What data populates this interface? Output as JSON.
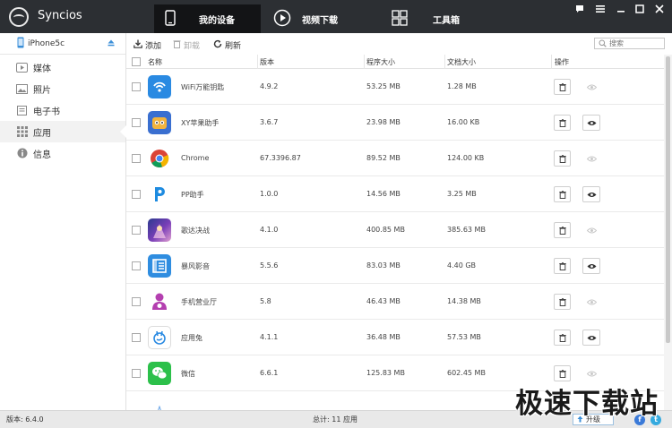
{
  "app": {
    "title": "Syncios"
  },
  "nav": {
    "tabs": [
      {
        "label": "我的设备",
        "icon": "phone-icon",
        "active": true
      },
      {
        "label": "视频下载",
        "icon": "play-icon",
        "active": false
      },
      {
        "label": "工具箱",
        "icon": "toolbox-icon",
        "active": false
      }
    ]
  },
  "window_controls": [
    "chat-icon",
    "menu-icon",
    "minimize-icon",
    "maximize-icon",
    "close-icon"
  ],
  "device": {
    "name": "iPhone5c"
  },
  "sidebar": {
    "items": [
      {
        "label": "媒体",
        "icon": "media-icon",
        "active": false
      },
      {
        "label": "照片",
        "icon": "photo-icon",
        "active": false
      },
      {
        "label": "电子书",
        "icon": "ebook-icon",
        "active": false
      },
      {
        "label": "应用",
        "icon": "apps-grid-icon",
        "active": true
      },
      {
        "label": "信息",
        "icon": "info-icon",
        "active": false
      }
    ]
  },
  "toolbar": {
    "add_label": "添加",
    "uninstall_label": "卸载",
    "refresh_label": "刷新",
    "search_placeholder": "搜索"
  },
  "table": {
    "columns": {
      "name": "名称",
      "version": "版本",
      "app_size": "程序大小",
      "doc_size": "文档大小",
      "action": "操作"
    },
    "rows": [
      {
        "name": "WiFi万能钥匙",
        "version": "4.9.2",
        "app_size": "53.25 MB",
        "doc_size": "1.28 MB",
        "icon": "wifi-key-icon",
        "browse_enabled": false
      },
      {
        "name": "XY苹果助手",
        "version": "3.6.7",
        "app_size": "23.98 MB",
        "doc_size": "16.00 KB",
        "icon": "xy-assistant-icon",
        "browse_enabled": true
      },
      {
        "name": "Chrome",
        "version": "67.3396.87",
        "app_size": "89.52 MB",
        "doc_size": "124.00 KB",
        "icon": "chrome-icon",
        "browse_enabled": false
      },
      {
        "name": "PP助手",
        "version": "1.0.0",
        "app_size": "14.56 MB",
        "doc_size": "3.25 MB",
        "icon": "pp-assistant-icon",
        "browse_enabled": true
      },
      {
        "name": "歌达决战",
        "version": "4.1.0",
        "app_size": "400.85 MB",
        "doc_size": "385.63 MB",
        "icon": "game-icon",
        "browse_enabled": false
      },
      {
        "name": "暴风影音",
        "version": "5.5.6",
        "app_size": "83.03 MB",
        "doc_size": "4.40 GB",
        "icon": "baofeng-icon",
        "browse_enabled": true
      },
      {
        "name": "手机营业厅",
        "version": "5.8",
        "app_size": "46.43 MB",
        "doc_size": "14.38 MB",
        "icon": "unicom-icon",
        "browse_enabled": false
      },
      {
        "name": "应用兔",
        "version": "4.1.1",
        "app_size": "36.48 MB",
        "doc_size": "57.53 MB",
        "icon": "app-rabbit-icon",
        "browse_enabled": true
      },
      {
        "name": "微信",
        "version": "6.6.1",
        "app_size": "125.83 MB",
        "doc_size": "602.45 MB",
        "icon": "wechat-icon",
        "browse_enabled": false
      }
    ]
  },
  "status": {
    "version": "版本: 6.4.0",
    "total": "总计: 11 应用",
    "upgrade_label": "升级"
  },
  "watermark": "极速下载站",
  "colors": {
    "titlebar": "#2c2f33",
    "accent": "#4a90d9",
    "wifi": "#2a8ae2",
    "wechat": "#2cc04a"
  }
}
